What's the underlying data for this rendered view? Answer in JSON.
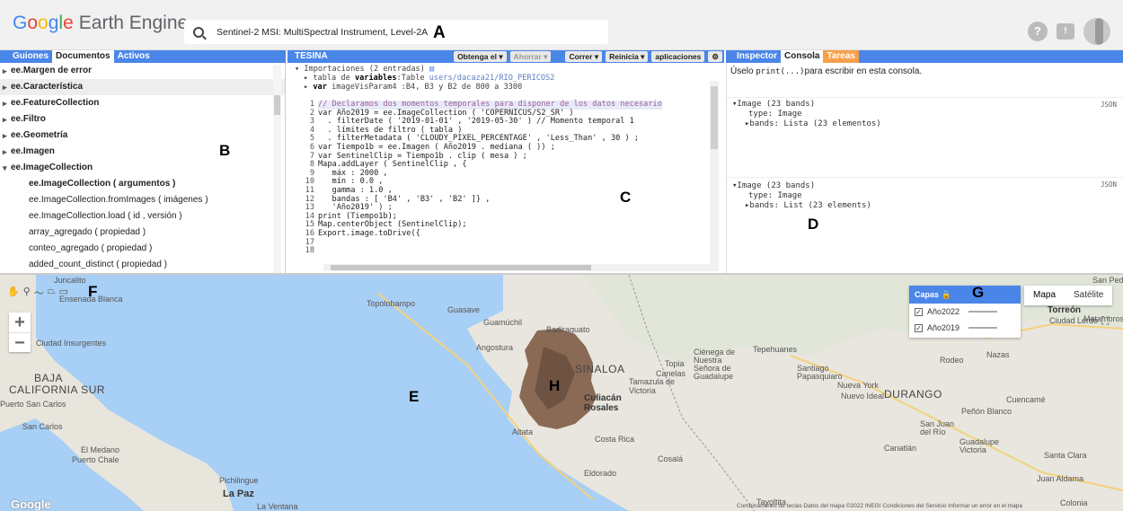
{
  "header": {
    "logo_brand": "Google",
    "logo_product": "Earth Engine",
    "search_text": "Sentinel-2 MSI: MultiSpectral Instrument, Level-2A",
    "help_icon": "?",
    "feedback_icon": "!"
  },
  "annotations": {
    "a": "A",
    "b": "B",
    "c": "C",
    "d": "D",
    "e": "E",
    "f": "F",
    "g": "G",
    "h": "H"
  },
  "left_panel": {
    "tabs": [
      "Guiones",
      "Documentos",
      "Activos"
    ],
    "active_tab": "Documentos",
    "items": [
      "ee.Margen de error",
      "ee.Característica",
      "ee.FeatureCollection",
      "ee.Filtro",
      "ee.Geometría",
      "ee.Imagen",
      "ee.ImageCollection"
    ],
    "sub_items": [
      "ee.ImageCollection ( argumentos )",
      "ee.ImageCollection.fromImages ( imágenes )",
      "ee.ImageCollection.load ( id , versión )",
      "array_agregado ( propiedad )",
      "conteo_agregado ( propiedad )",
      "added_count_distinct ( propiedad )"
    ]
  },
  "editor": {
    "title": "TESINA",
    "buttons": {
      "get_link": "Obtenga el",
      "save": "Ahorrar",
      "run": "Correr",
      "reset": "Reinicia",
      "apps": "aplicaciones"
    },
    "imports_header": "Importaciones (2 entradas)",
    "imports": [
      {
        "prefix": "tabla de",
        "kw": "variables",
        "rest": ":Table ",
        "link": "users/dacaza21/RIO_PERICOS2"
      },
      {
        "prefix": "",
        "kw": "var",
        "rest": " imageVisParam4 :B4, B3 y B2 de 800 a 3300",
        "link": ""
      }
    ],
    "line_numbers": [
      "1",
      "2",
      "3",
      "4",
      "5",
      "6",
      "7",
      "8",
      "9",
      "10",
      "11",
      "12",
      "13",
      "14",
      "15",
      "16",
      "17",
      "18"
    ],
    "lines": [
      "// Declaramos dos momentos temporales para disponer de los datos necesario",
      "var Año2019 = ee.ImageCollection ( 'COPERNICUS/S2_SR' )",
      "  . filterDate ( '2019-01-01' , '2019-05-30' ) // Momento temporal 1",
      "  . límites de filtro ( tabla )",
      "  . filterMetadata ( 'CLOUDY_PIXEL_PERCENTAGE' , 'Less_Than' , 30 ) ;",
      "var Tiempo1b = ee.Imagen ( Año2019 . mediana ( )) ;",
      "var SentinelClip = Tiempo1b . clip ( mesa ) ;",
      "Mapa.addLayer ( SentinelClip , {",
      "   máx : 2000 ,",
      "   mín : 0.0 ,",
      "   gamma : 1.0 ,",
      "   bandas : [ 'B4' , 'B3' , 'B2' ]} ,",
      "   'Año2019' ) ;",
      "print (Tiempo1b);",
      "Map.centerObject (SentinelClip);",
      "Export.image.toDrive({",
      "",
      ""
    ]
  },
  "console": {
    "tabs": [
      "Inspector",
      "Consola",
      "Tareas"
    ],
    "active_tab": "Consola",
    "hint_pre": "Úselo ",
    "hint_code": "print(...)",
    "hint_post": "para escribir en esta consola.",
    "outputs": [
      {
        "title": "Image (23 bands)",
        "type": "type: Image",
        "bands": "bands: Lista (23 elementos)",
        "json": "JSON"
      },
      {
        "title": "Image (23 bands)",
        "type": "type: Image",
        "bands": "bands: List (23 elements)",
        "json": "JSON"
      }
    ]
  },
  "map": {
    "layers_title": "Capas",
    "layers": [
      "Año2022",
      "Año2019"
    ],
    "map_types": [
      "Mapa",
      "Satélite"
    ],
    "zoom_in": "+",
    "zoom_out": "−",
    "google": "Google",
    "footer": "Combinaciones de teclas    Datos del mapa ©2022 INEGI   Condiciones del Servicio   Informar un error en el mapa",
    "labels": [
      "Juncalito",
      "Ensenada Blanca",
      "Ciudad Insurgentes",
      "BAJA",
      "CALIFORNIA SUR",
      "Puerto San Carlos",
      "San Carlos",
      "El Medano",
      "Puerto Chale",
      "Pichilingue",
      "La Paz",
      "La Ventana",
      "Topolobampo",
      "Guasave",
      "Guamúchil",
      "Badiraguato",
      "Angostura",
      "SINALOA",
      "Tamazula de Victoria",
      "Culiacán Rosales",
      "Altata",
      "Costa Rica",
      "Cosalá",
      "Eldorado",
      "Tayoltita",
      "Topia",
      "Canelas",
      "Ciénega de Nuestra Señora de Guadalupe",
      "Tepehuanes",
      "Santiago Papasquiaro",
      "Nueva York",
      "Nuevo Ideal",
      "DURANGO",
      "Rodeo",
      "Nazas",
      "Cuencamé",
      "Peñón Blanco",
      "San Juan del Río",
      "Canatlán",
      "Guadalupe Victoria",
      "Santa Clara",
      "Juan Aldama",
      "Torreón",
      "Ciudad Lerdo",
      "Matamoros",
      "Colonia",
      "San Pedro"
    ]
  },
  "colors": {
    "accent": "#4a86e8",
    "tasks": "#f6a04d",
    "land": "#e9e6df",
    "sea": "#a8cff5",
    "roi": "#8a6a55"
  }
}
